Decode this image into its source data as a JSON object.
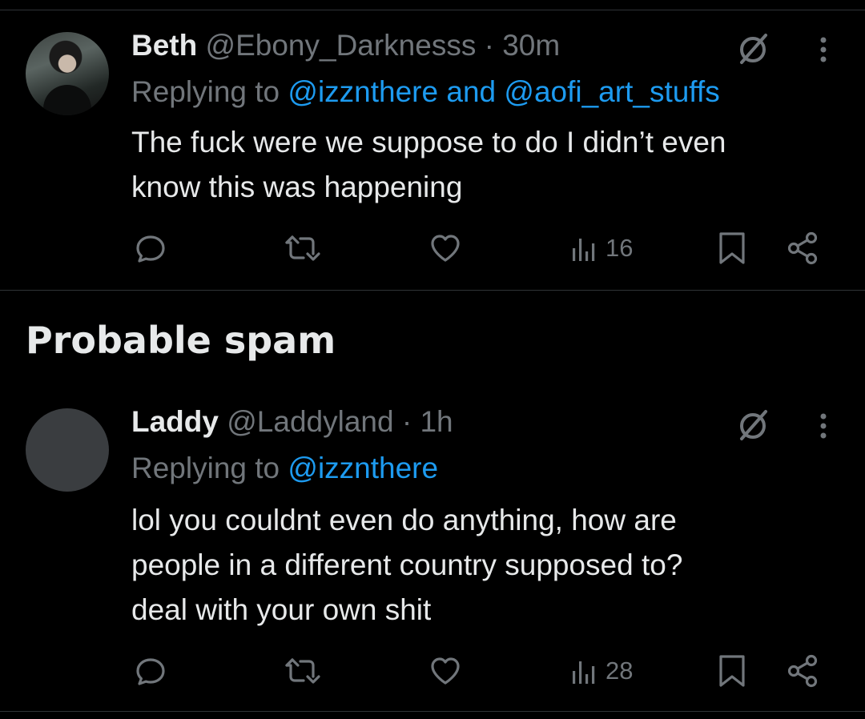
{
  "tweets": [
    {
      "name": "Beth",
      "handle": "@Ebony_Darknesss",
      "separator": "·",
      "time": "30m",
      "replying_prefix": "Replying to ",
      "mentions": [
        "@izznthere",
        "@aofi_art_stuffs"
      ],
      "mention_joiner": " and ",
      "text_lines": [
        "The fuck were we suppose to do I didn’t even",
        "know this was happening"
      ],
      "views": "16",
      "avatar": "photo"
    },
    {
      "name": "Laddy",
      "handle": "@Laddyland",
      "separator": "·",
      "time": "1h",
      "replying_prefix": "Replying to ",
      "mentions": [
        "@izznthere"
      ],
      "text_lines": [
        "lol you couldnt even do anything, how are",
        "people in a different country supposed to?",
        "deal with your own shit"
      ],
      "views": "28",
      "avatar": "default"
    }
  ],
  "section": {
    "title": "Probable spam"
  },
  "icons": {
    "reply": "reply-icon",
    "retweet": "retweet-icon",
    "like": "heart-icon",
    "views": "views-bar-chart-icon",
    "bookmark": "bookmark-icon",
    "share": "share-icon",
    "grok": "grok-slash-icon",
    "more": "more-vertical-icon"
  },
  "colors": {
    "background": "#000000",
    "text_primary": "#e7e9ea",
    "text_secondary": "#71767b",
    "link": "#1d9bf0",
    "divider": "#2f3336"
  }
}
